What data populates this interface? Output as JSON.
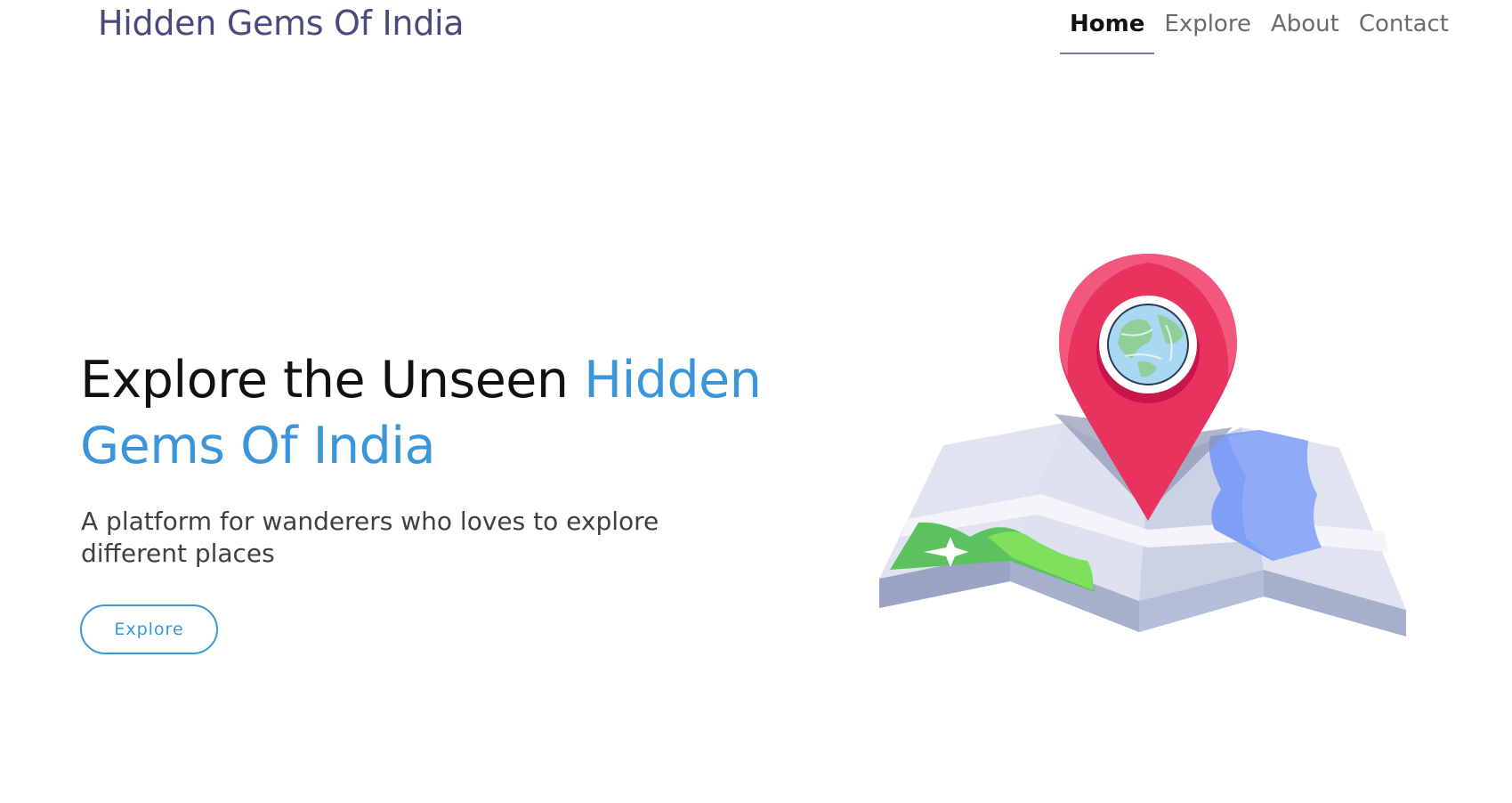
{
  "header": {
    "brand": "Hidden Gems Of India",
    "nav": [
      {
        "label": "Home",
        "active": true
      },
      {
        "label": "Explore",
        "active": false
      },
      {
        "label": "About",
        "active": false
      },
      {
        "label": "Contact",
        "active": false
      }
    ]
  },
  "hero": {
    "title_main": "Explore the Unseen ",
    "title_accent": "Hidden Gems Of India",
    "subtitle": "A platform for wanderers who loves to explore different places",
    "button_label": "Explore",
    "illustration": "map-location-pin-globe-illustration"
  },
  "colors": {
    "brand": "#4b4a7e",
    "accent": "#3a96d8",
    "pin": "#e8335f",
    "map_land": "#5cc25f",
    "map_water": "#7f9ef5"
  }
}
